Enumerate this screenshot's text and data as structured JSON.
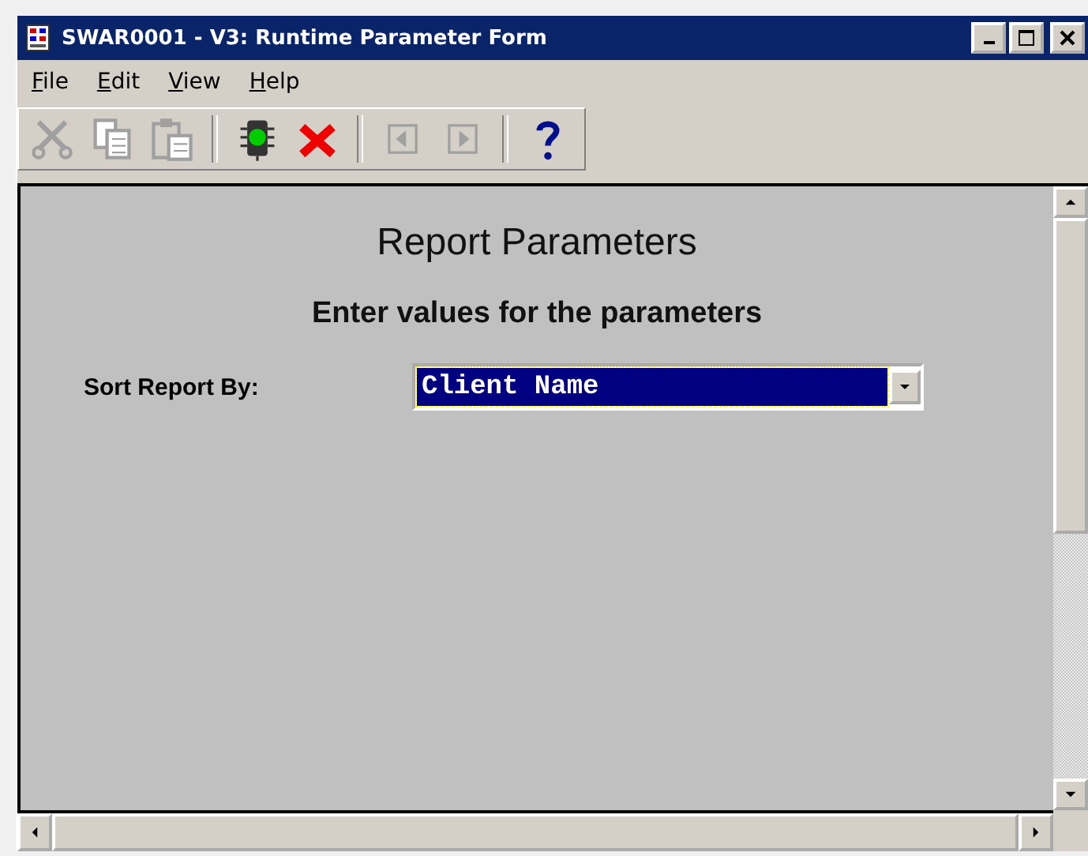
{
  "window": {
    "title": "SWAR0001 - V3: Runtime Parameter Form"
  },
  "menu": [
    {
      "label": "File"
    },
    {
      "label": "Edit"
    },
    {
      "label": "View"
    },
    {
      "label": "Help"
    }
  ],
  "toolbar": [
    {
      "kind": "cut",
      "disabled": true
    },
    {
      "kind": "copy",
      "disabled": true
    },
    {
      "kind": "paste",
      "disabled": true
    },
    {
      "kind": "separator"
    },
    {
      "kind": "run",
      "disabled": false
    },
    {
      "kind": "cancel",
      "disabled": false
    },
    {
      "kind": "separator"
    },
    {
      "kind": "prev",
      "disabled": true
    },
    {
      "kind": "next",
      "disabled": true
    },
    {
      "kind": "separator"
    },
    {
      "kind": "help",
      "disabled": false
    }
  ],
  "form": {
    "title": "Report Parameters",
    "subtitle": "Enter values for the parameters",
    "fields": [
      {
        "label": "Sort Report By:",
        "value": "Client Name",
        "selected": true
      }
    ]
  }
}
